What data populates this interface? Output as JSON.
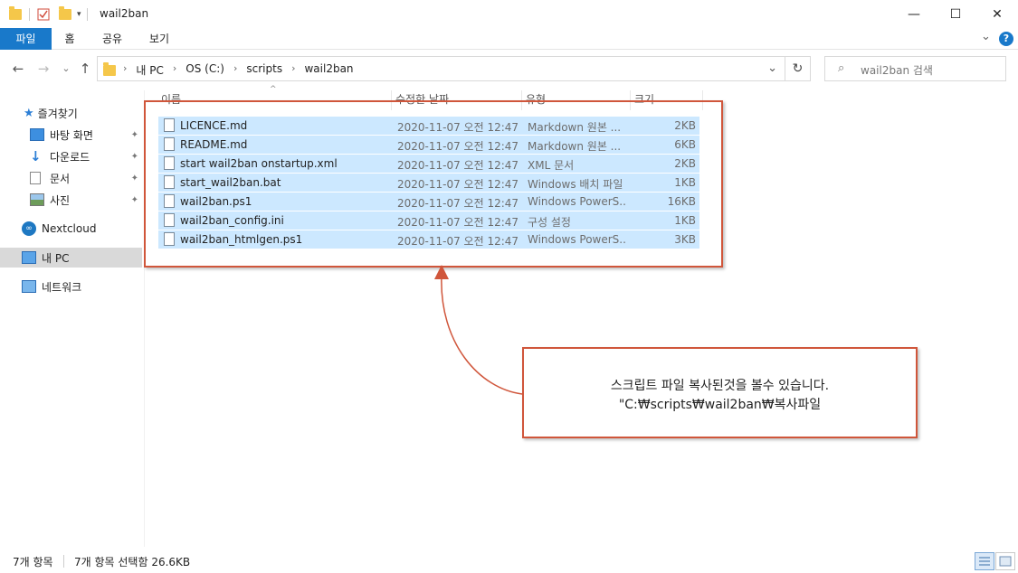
{
  "window": {
    "title": "wail2ban",
    "minimize_glyph": "—",
    "maximize_glyph": "☐",
    "close_glyph": "✕"
  },
  "ribbon": {
    "tabs": [
      "파일",
      "홈",
      "공유",
      "보기"
    ],
    "expand_glyph": "⌄",
    "help_glyph": "?"
  },
  "address": {
    "crumbs": [
      "내 PC",
      "OS (C:)",
      "scripts",
      "wail2ban"
    ],
    "separator": "›",
    "dropdown_glyph": "⌄",
    "refresh_glyph": "↻"
  },
  "search": {
    "placeholder": "wail2ban 검색",
    "icon": "search-icon"
  },
  "nav": {
    "back": "←",
    "forward": "→",
    "recent": "⌄",
    "up": "↑"
  },
  "sidebar": {
    "quick_access": "즐겨찾기",
    "items": [
      {
        "label": "바탕 화면",
        "icon": "desktop-icon",
        "pinned": true
      },
      {
        "label": "다운로드",
        "icon": "download-icon",
        "pinned": true
      },
      {
        "label": "문서",
        "icon": "document-icon",
        "pinned": true
      },
      {
        "label": "사진",
        "icon": "picture-icon",
        "pinned": true
      }
    ],
    "nextcloud": "Nextcloud",
    "this_pc": "내 PC",
    "network": "네트워크",
    "pin_glyph": "📌"
  },
  "columns": {
    "name": "이름",
    "date": "수정한 날짜",
    "type": "유형",
    "size": "크기"
  },
  "files": [
    {
      "name": "LICENCE.md",
      "date": "2020-11-07 오전 12:47",
      "type": "Markdown 원본 ...",
      "size": "2KB"
    },
    {
      "name": "README.md",
      "date": "2020-11-07 오전 12:47",
      "type": "Markdown 원본 ...",
      "size": "6KB"
    },
    {
      "name": "start wail2ban onstartup.xml",
      "date": "2020-11-07 오전 12:47",
      "type": "XML 문서",
      "size": "2KB"
    },
    {
      "name": "start_wail2ban.bat",
      "date": "2020-11-07 오전 12:47",
      "type": "Windows 배치 파일",
      "size": "1KB"
    },
    {
      "name": "wail2ban.ps1",
      "date": "2020-11-07 오전 12:47",
      "type": "Windows PowerS...",
      "size": "16KB"
    },
    {
      "name": "wail2ban_config.ini",
      "date": "2020-11-07 오전 12:47",
      "type": "구성 설정",
      "size": "1KB"
    },
    {
      "name": "wail2ban_htmlgen.ps1",
      "date": "2020-11-07 오전 12:47",
      "type": "Windows PowerS...",
      "size": "3KB"
    }
  ],
  "annotation": {
    "line1": "스크립트 파일 복사된것을 볼수 있습니다.",
    "line2": "\"C:₩scripts₩wail2ban₩복사파일",
    "color": "#d0563b"
  },
  "status": {
    "count": "7개 항목",
    "selected": "7개 항목 선택함 26.6KB"
  }
}
